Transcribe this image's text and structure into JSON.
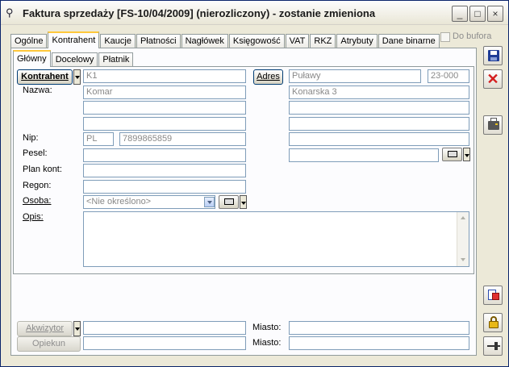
{
  "window": {
    "title": "Faktura sprzedaży [FS-10/04/2009] (nierozliczony) - zostanie zmieniona",
    "controls": [
      "_",
      "□",
      "×"
    ]
  },
  "tabs": [
    "Ogólne",
    "Kontrahent",
    "Kaucje",
    "Płatności",
    "Nagłówek",
    "Księgowość",
    "VAT",
    "RKZ",
    "Atrybuty",
    "Dane binarne"
  ],
  "do_bufora": "Do bufora",
  "subtabs": [
    "Główny",
    "Docelowy",
    "Płatnik"
  ],
  "form": {
    "kontrahent_button": "Kontrahent",
    "kontrahent_value": "K1",
    "adres_button": "Adres",
    "miasto_value": "Puławy",
    "kod_value": "23-000",
    "nazwa_label": "Nazwa:",
    "nazwa_value": "Komar",
    "ulica_value": "Konarska 3",
    "nip_label": "Nip:",
    "nip_prefix": "PL",
    "nip_value": "7899865859",
    "pesel_label": "Pesel:",
    "plan_kont_label": "Plan kont:",
    "regon_label": "Regon:",
    "osoba_label": "Osoba:",
    "osoba_value": "<Nie określono>",
    "opis_label": "Opis:"
  },
  "bottom": {
    "akwizytor_button": "Akwizytor",
    "opiekun_button": "Opiekun",
    "miasto_label_1": "Miasto:",
    "miasto_label_2": "Miasto:"
  },
  "icons": {
    "save": "floppy-disk-icon",
    "cancel": "red-x-icon",
    "print": "printer-icon",
    "docs": "documents-icon",
    "lock": "padlock-icon",
    "pin": "pushpin-icon"
  }
}
